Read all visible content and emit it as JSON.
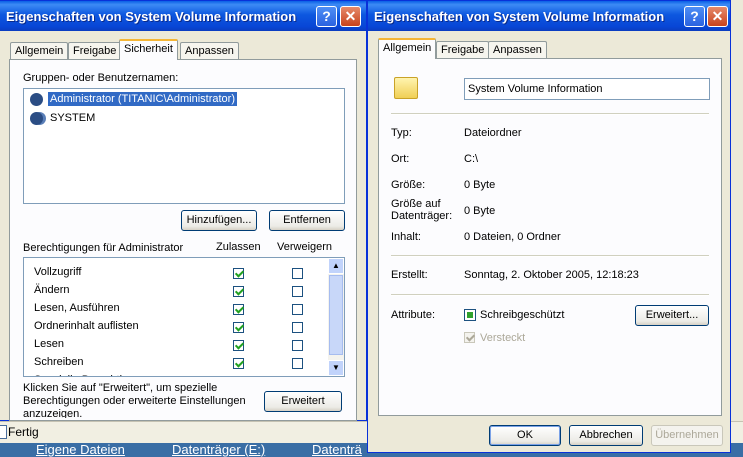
{
  "background": {
    "status": "Fertig",
    "links": [
      "Eigene Dateien",
      "Datenträger (E:)",
      "Datenträ"
    ]
  },
  "win1": {
    "title": "Eigenschaften von System Volume Information",
    "tabs": [
      "Allgemein",
      "Freigabe",
      "Sicherheit",
      "Anpassen"
    ],
    "groups_label": "Gruppen- oder Benutzernamen:",
    "users": [
      "Administrator (TITANIC\\Administrator)",
      "SYSTEM"
    ],
    "add_button": "Hinzufügen...",
    "remove_button": "Entfernen",
    "perm_label": "Berechtigungen für Administrator",
    "col_allow": "Zulassen",
    "col_deny": "Verweigern",
    "permissions": [
      {
        "name": "Vollzugriff",
        "allow": true,
        "deny": false
      },
      {
        "name": "Ändern",
        "allow": true,
        "deny": false
      },
      {
        "name": "Lesen, Ausführen",
        "allow": true,
        "deny": false
      },
      {
        "name": "Ordnerinhalt auflisten",
        "allow": true,
        "deny": false
      },
      {
        "name": "Lesen",
        "allow": true,
        "deny": false
      },
      {
        "name": "Schreiben",
        "allow": true,
        "deny": false
      },
      {
        "name": "Spezielle Berechtigungen",
        "allow": false,
        "deny": false
      }
    ],
    "advanced_text": "Klicken Sie auf \"Erweitert\", um spezielle Berechtigungen oder erweiterte Einstellungen anzuzeigen.",
    "advanced_button": "Erweitert"
  },
  "win2": {
    "title": "Eigenschaften von System Volume Information",
    "tabs": [
      "Allgemein",
      "Freigabe",
      "Anpassen"
    ],
    "name_value": "System Volume Information",
    "rows": {
      "typ": {
        "label": "Typ:",
        "value": "Dateiordner"
      },
      "ort": {
        "label": "Ort:",
        "value": "C:\\"
      },
      "groesse": {
        "label": "Größe:",
        "value": "0 Byte"
      },
      "groesse_dt": {
        "label": "Größe auf Datenträger:",
        "value": "0 Byte"
      },
      "inhalt": {
        "label": "Inhalt:",
        "value": "0 Dateien, 0 Ordner"
      },
      "erstellt": {
        "label": "Erstellt:",
        "value": "Sonntag, 2. Oktober 2005, 12:18:23"
      }
    },
    "attrib_label": "Attribute:",
    "readonly_label": "Schreibgeschützt",
    "hidden_label": "Versteckt",
    "advanced_button": "Erweitert...",
    "ok_button": "OK",
    "cancel_button": "Abbrechen",
    "apply_button": "Übernehmen"
  }
}
